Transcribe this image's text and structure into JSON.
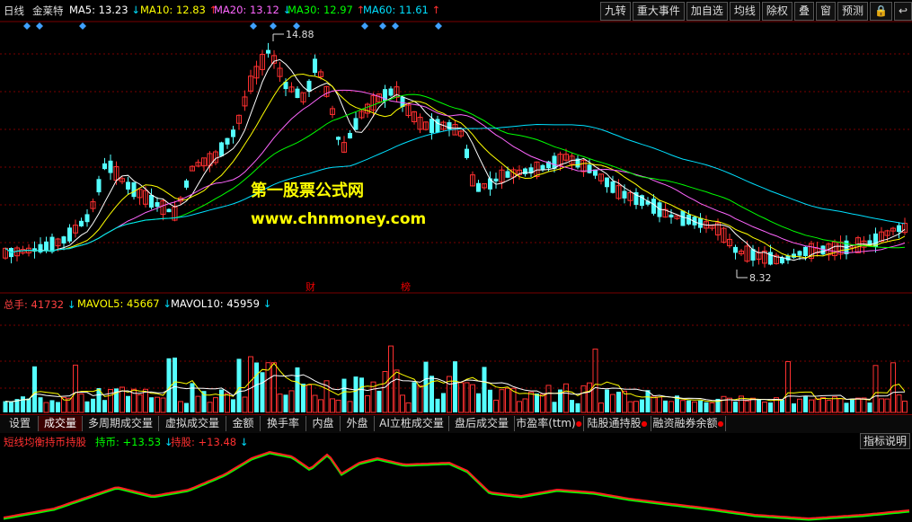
{
  "header": {
    "period": "日线",
    "stock_name": "金莱特",
    "ma": [
      {
        "label": "MA5: 13.23",
        "arrow": "↓",
        "color": "#ffffff",
        "arrow_color": "#00e0ff"
      },
      {
        "label": "MA10: 12.83",
        "arrow": "↑",
        "color": "#ffff00",
        "arrow_color": "#ff3030"
      },
      {
        "label": "MA20: 13.12",
        "arrow": "↓",
        "color": "#ff66ff",
        "arrow_color": "#00e0ff"
      },
      {
        "label": "MA30: 12.97",
        "arrow": "↑",
        "color": "#00ff00",
        "arrow_color": "#ff3030"
      },
      {
        "label": "MA60: 11.61",
        "arrow": "↑",
        "color": "#00e0ff",
        "arrow_color": "#ff3030"
      }
    ],
    "buttons": [
      "九转",
      "重大事件",
      "加自选",
      "均线",
      "除权",
      "叠",
      "窗",
      "预测"
    ],
    "icons": [
      "lock-icon",
      "back-icon"
    ]
  },
  "price_chart": {
    "high_label": "14.88",
    "low_label": "8.32",
    "annotations": [
      "财",
      "榜"
    ],
    "watermark_line1": "第一股票公式网",
    "watermark_line2": "www.chnmoney.com"
  },
  "volume": {
    "label": "总手: 41732",
    "label_arrow": "↓",
    "mavol5": "MAVOL5: 45667",
    "mavol5_arrow": "↓",
    "mavol10": "MAVOL10: 45959",
    "mavol10_arrow": "↓"
  },
  "tabs": [
    {
      "label": "设置",
      "active": false,
      "dot": false
    },
    {
      "label": "成交量",
      "active": true,
      "dot": false
    },
    {
      "label": "多周期成交量",
      "active": false,
      "dot": false
    },
    {
      "label": "虚拟成交量",
      "active": false,
      "dot": false
    },
    {
      "label": "金额",
      "active": false,
      "dot": false
    },
    {
      "label": "换手率",
      "active": false,
      "dot": false
    },
    {
      "label": "内盘",
      "active": false,
      "dot": false
    },
    {
      "label": "外盘",
      "active": false,
      "dot": false
    },
    {
      "label": "AI立桩成交量",
      "active": false,
      "dot": false
    },
    {
      "label": "盘后成交量",
      "active": false,
      "dot": false
    },
    {
      "label": "市盈率(ttm)",
      "active": false,
      "dot": true
    },
    {
      "label": "陆股通持股",
      "active": false,
      "dot": true
    },
    {
      "label": "融资融券余额",
      "active": false,
      "dot": true
    }
  ],
  "indicator": {
    "name": "短线均衡持币持股",
    "hold_cash": "持币: +13.53",
    "hold_cash_arrow": "↓",
    "hold_stock": "持股: +13.48",
    "hold_stock_arrow": "↓",
    "help_button": "指标说明"
  },
  "colors": {
    "up": "#ff3030",
    "down": "#54ffff",
    "ma5": "#ffffff",
    "ma10": "#ffff00",
    "ma20": "#ff66ff",
    "ma30": "#00ff00",
    "ma60": "#00e0ff",
    "indicator_red": "#ff2020",
    "indicator_green": "#00ff00"
  }
}
